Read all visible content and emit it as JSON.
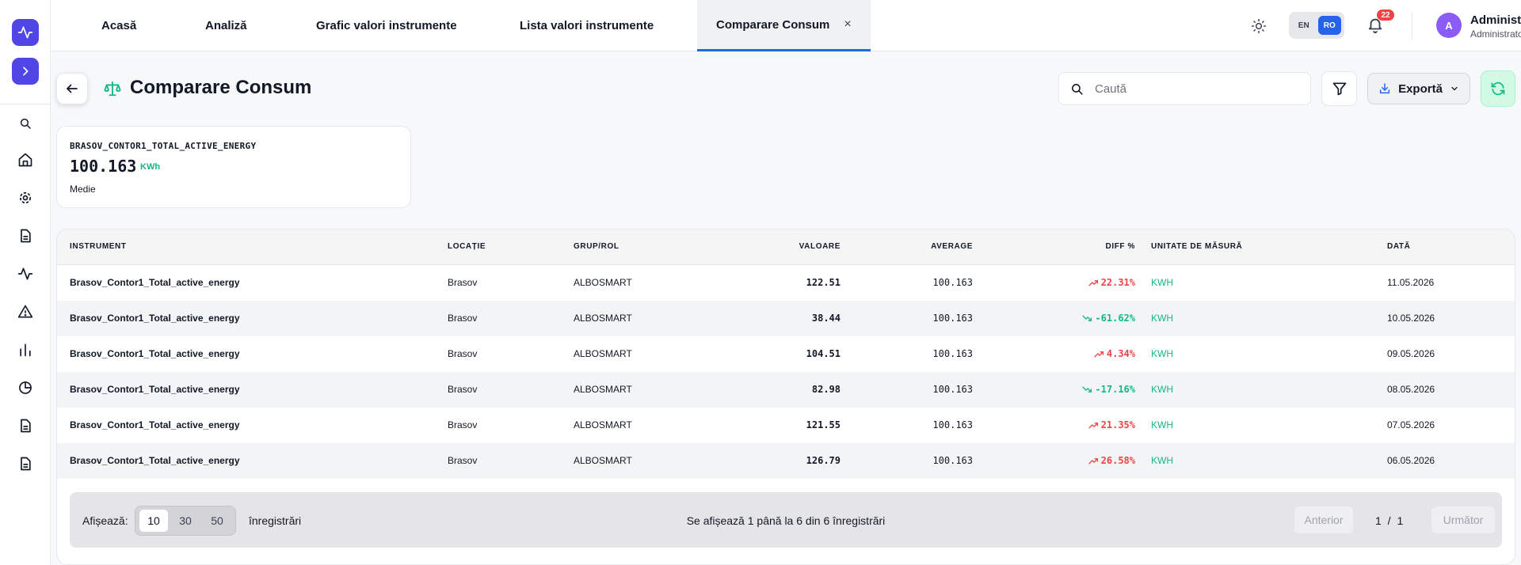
{
  "colors": {
    "accent": "#2563eb",
    "brand": "#4f46e5",
    "positive": "#10b981",
    "negative": "#ef4444"
  },
  "tabs": [
    {
      "label": "Acasă"
    },
    {
      "label": "Analiză"
    },
    {
      "label": "Grafic valori instrumente"
    },
    {
      "label": "Lista valori instrumente"
    },
    {
      "label": "Comparare Consum",
      "active": true,
      "close": "×"
    }
  ],
  "lang": {
    "en": "EN",
    "ro": "RO",
    "selected": "RO"
  },
  "notifications": {
    "count": "22"
  },
  "user": {
    "initial": "A",
    "name": "Administrator",
    "role": "Administrator"
  },
  "sidebar": {
    "icons": [
      "activity-icon",
      "chevron-right-icon",
      "search-icon",
      "home-icon",
      "gear-icon",
      "document-icon",
      "activity-icon",
      "warning-icon",
      "bar-chart-icon",
      "pie-chart-icon",
      "document-icon",
      "document-icon"
    ]
  },
  "page": {
    "title": "Comparare Consum",
    "title_icon": "scale-icon",
    "search_placeholder": "Caută",
    "export_label": "Exportă"
  },
  "stat": {
    "label": "BRASOV_CONTOR1_TOTAL_ACTIVE_ENERGY",
    "value": "100.163",
    "unit": "KWh",
    "sub": "Medie"
  },
  "table": {
    "headers": [
      "Instrument",
      "Locație",
      "Grup/Rol",
      "Valoare",
      "Average",
      "Diff %",
      "Unitate de măsură",
      "Dată"
    ],
    "rows": [
      {
        "instrument": "Brasov_Contor1_Total_active_energy",
        "location": "Brasov",
        "group": "ALBOSMART",
        "value": "122.51",
        "average": "100.163",
        "diff": "22.31%",
        "trend": "up",
        "unit": "KWH",
        "date": "11.05.2026"
      },
      {
        "instrument": "Brasov_Contor1_Total_active_energy",
        "location": "Brasov",
        "group": "ALBOSMART",
        "value": "38.44",
        "average": "100.163",
        "diff": "-61.62%",
        "trend": "down",
        "unit": "KWH",
        "date": "10.05.2026"
      },
      {
        "instrument": "Brasov_Contor1_Total_active_energy",
        "location": "Brasov",
        "group": "ALBOSMART",
        "value": "104.51",
        "average": "100.163",
        "diff": "4.34%",
        "trend": "up",
        "unit": "KWH",
        "date": "09.05.2026"
      },
      {
        "instrument": "Brasov_Contor1_Total_active_energy",
        "location": "Brasov",
        "group": "ALBOSMART",
        "value": "82.98",
        "average": "100.163",
        "diff": "-17.16%",
        "trend": "down",
        "unit": "KWH",
        "date": "08.05.2026"
      },
      {
        "instrument": "Brasov_Contor1_Total_active_energy",
        "location": "Brasov",
        "group": "ALBOSMART",
        "value": "121.55",
        "average": "100.163",
        "diff": "21.35%",
        "trend": "up",
        "unit": "KWH",
        "date": "07.05.2026"
      },
      {
        "instrument": "Brasov_Contor1_Total_active_energy",
        "location": "Brasov",
        "group": "ALBOSMART",
        "value": "126.79",
        "average": "100.163",
        "diff": "26.58%",
        "trend": "up",
        "unit": "KWH",
        "date": "06.05.2026"
      }
    ]
  },
  "pagination": {
    "show_label": "Afișează:",
    "sizes": [
      "10",
      "30",
      "50"
    ],
    "selected_size": "10",
    "records_label": "înregistrări",
    "info": "Se afișează 1 până la 6 din 6 înregistrări",
    "prev": "Anterior",
    "page": "1 / 1",
    "next": "Următor"
  }
}
